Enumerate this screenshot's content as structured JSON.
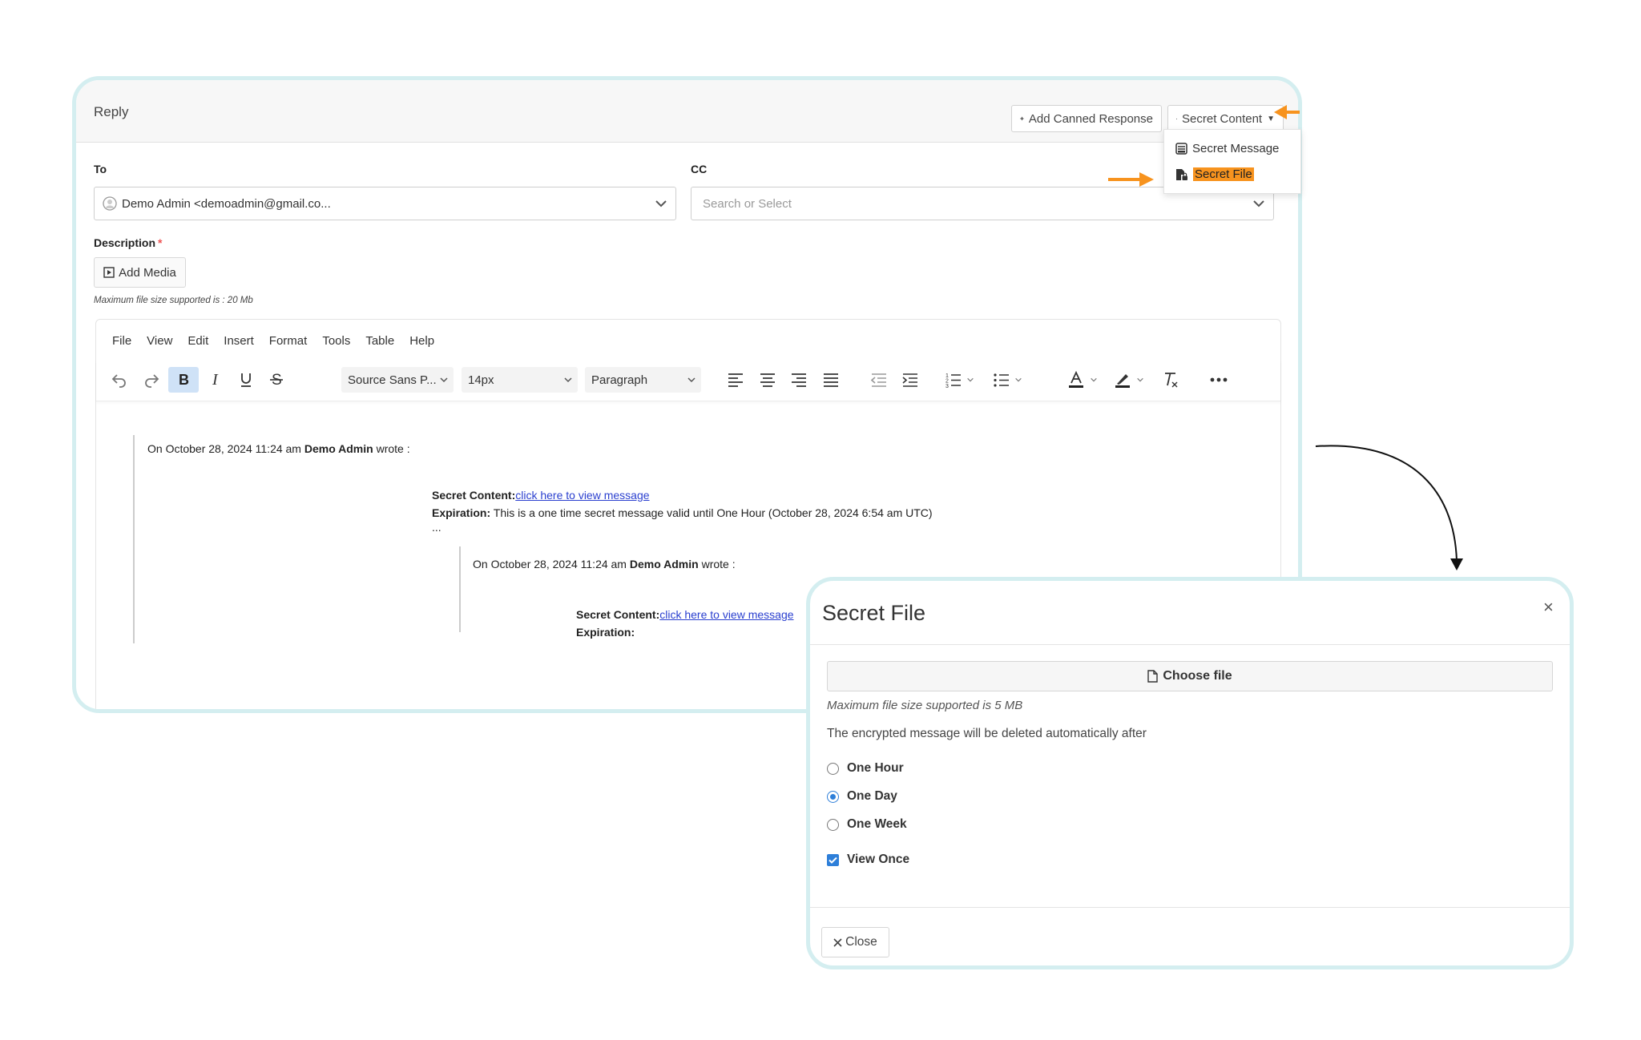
{
  "reply": {
    "title": "Reply",
    "add_canned_label": "Add Canned Response",
    "secret_content_label": "Secret Content",
    "menu": {
      "secret_message": "Secret Message",
      "secret_file": "Secret File"
    },
    "to_label": "To",
    "to_value": "Demo Admin <demoadmin@gmail.co...",
    "cc_label": "CC",
    "cc_placeholder": "Search or Select",
    "description_label": "Description",
    "required_mark": "*",
    "add_media_label": "Add Media",
    "max_file_note": "Maximum file size supported is : 20 Mb"
  },
  "editor": {
    "menubar": [
      "File",
      "View",
      "Edit",
      "Insert",
      "Format",
      "Tools",
      "Table",
      "Help"
    ],
    "font_family": "Source Sans P...",
    "font_size": "14px",
    "block_format": "Paragraph",
    "content": {
      "wrote_prefix": "On October 28, 2024 11:24 am ",
      "author": "Demo Admin",
      "wrote_suffix": " wrote :",
      "secret_label": "Secret Content:",
      "link_text": "click here to view message",
      "expiration_label": "Expiration:",
      "expiration_text": " This is a one time secret message valid until One Hour (October 28, 2024 6:54 am UTC)",
      "ellipsis": "...",
      "inner_wrote_prefix": "On October 28, 2024 11:24 am ",
      "inner_author": "Demo Admin",
      "inner_wrote_suffix": " wrote :",
      "inner_secret_label": "Secret Content:",
      "inner_link_text": "click here to view message",
      "inner_expiration_label": "Expiration:"
    }
  },
  "modal": {
    "title": "Secret File",
    "close_x": "×",
    "choose_file_label": "Choose file",
    "max_size_note": "Maximum file size supported is 5 MB",
    "delete_note": "The encrypted message will be deleted automatically after",
    "options": [
      {
        "label": "One Hour",
        "selected": false
      },
      {
        "label": "One Day",
        "selected": true
      },
      {
        "label": "One Week",
        "selected": false
      }
    ],
    "view_once_label": "View Once",
    "view_once_checked": true,
    "close_label": "Close"
  },
  "colors": {
    "frame_border": "#d4eef0",
    "highlight": "#f7931e",
    "arrow": "#f7931e",
    "accent": "#2e7fd9",
    "link": "#2a3fcf"
  },
  "icons": [
    "plus-icon",
    "lock-icon",
    "caret-down-icon",
    "message-icon",
    "file-lock-icon",
    "avatar-icon",
    "chevron-down-icon",
    "media-icon",
    "undo-icon",
    "redo-icon",
    "bold-icon",
    "italic-icon",
    "underline-icon",
    "strikethrough-icon",
    "align-left-icon",
    "align-center-icon",
    "align-right-icon",
    "align-justify-icon",
    "outdent-icon",
    "indent-icon",
    "numbered-list-icon",
    "bullet-list-icon",
    "text-color-icon",
    "highlight-icon",
    "clear-format-icon",
    "more-icon",
    "file-icon",
    "close-icon"
  ]
}
